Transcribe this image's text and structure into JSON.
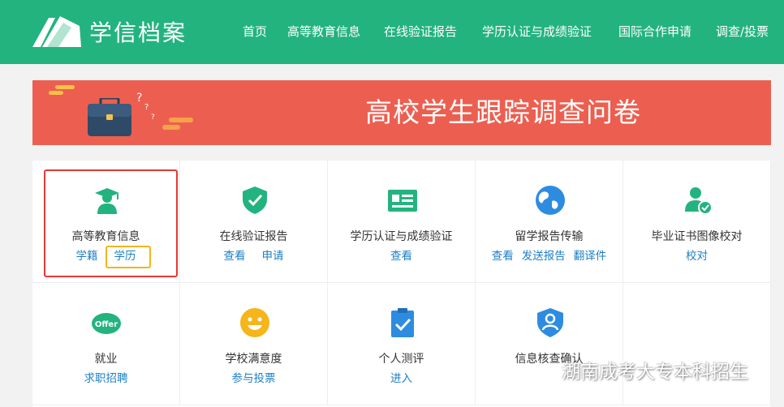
{
  "header": {
    "brand": "学信档案",
    "nav": [
      "首页",
      "高等教育信息",
      "在线验证报告",
      "学历认证与成绩验证",
      "国际合作申请",
      "调查/投票"
    ]
  },
  "banner": {
    "title": "高校学生跟踪调查问卷"
  },
  "cards": [
    {
      "title": "高等教育信息",
      "links": [
        "学籍",
        "学历"
      ],
      "icon": "graduate-icon"
    },
    {
      "title": "在线验证报告",
      "links": [
        "查看",
        "申请"
      ],
      "icon": "shield-check-icon"
    },
    {
      "title": "学历认证与成绩验证",
      "links": [
        "查看"
      ],
      "icon": "certificate-card-icon"
    },
    {
      "title": "留学报告传输",
      "links": [
        "查看",
        "发送报告",
        "翻译件"
      ],
      "icon": "globe-icon"
    },
    {
      "title": "毕业证书图像校对",
      "links": [
        "校对"
      ],
      "icon": "user-check-icon"
    },
    {
      "title": "就业",
      "links": [
        "求职招聘"
      ],
      "icon": "offer-icon",
      "badge": "Offer"
    },
    {
      "title": "学校满意度",
      "links": [
        "参与投票"
      ],
      "icon": "smiley-icon"
    },
    {
      "title": "个人测评",
      "links": [
        "进入"
      ],
      "icon": "clipboard-check-icon"
    },
    {
      "title": "信息核查确认",
      "links": [],
      "icon": "shield-user-icon"
    }
  ],
  "watermark": "湖南成考大专本科招生",
  "colors": {
    "header": "#23b37f",
    "banner": "#ec5f50",
    "link": "#1e7fc4",
    "highlight_red": "#e53935",
    "highlight_yellow": "#f3b51c"
  }
}
